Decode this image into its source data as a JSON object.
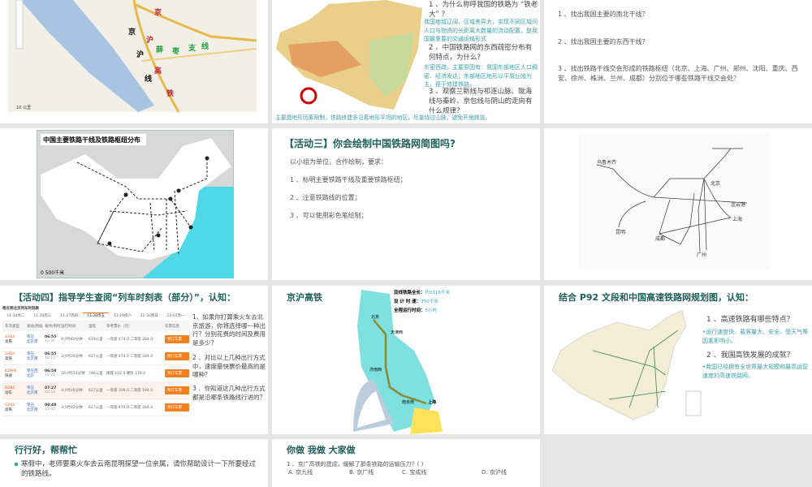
{
  "slide1": {
    "map_labels": [
      "京",
      "沪",
      "线",
      "京",
      "沪",
      "高",
      "铁",
      "薛",
      "枣",
      "支",
      "线"
    ],
    "scale": "10 公里"
  },
  "slide2": {
    "q1": "1 、为什么称呼我国的铁路为 “铁老大” ？",
    "a1": "我国地域辽阔，区域差异大，实现不同区域间人口与物资的长距离大数量的流动配置，是我国最重要的交通运输形式",
    "q2": "2 、中国铁路网的东西疏密分布有何特点，为什么？",
    "a2": "东密西疏。主要原因有：我国东部地区人口稠密、经济发达；东部地区地形以平原丘陵为主，便于修建铁路。",
    "q3": "3 、观察兰新线与祁连山脉、陇海线与秦岭、京包线与阴山的走向有什么规律？",
    "a3": "主要受地形因素限制，铁路修建多沿着地形平坦的地区，尽量绕过山脉，避免开凿隧道。"
  },
  "slide3": {
    "items": [
      "1 、找出我国主要的南北干线？",
      "2 、找出我国主要的东西干线？",
      "3 、找出铁路干线交会形成的铁路枢纽（北京、上海、广州、郑州、沈阳、重庆、西安、徐州、株洲、兰州、成都）分别位于哪些铁路干线交会处？"
    ]
  },
  "slide4": {
    "title": "中国主要铁路干线及铁路枢纽分布",
    "scale": "0      500千米"
  },
  "slide5": {
    "title": "【活动三】你会绘制中国铁路网简图吗?",
    "intro": "以小组为单位，合作绘制，要求：",
    "items": [
      "1 、标明主要铁路干线及重要铁路枢纽；",
      "2 、注意铁路线的位置；",
      "3 、可以使用彩色笔绘制；"
    ]
  },
  "slide6": {
    "labels": [
      "上海",
      "广州",
      "乌鲁木齐",
      "北京",
      "连云港",
      "昆明",
      "成都"
    ]
  },
  "slide7": {
    "title": "【活动四】指导学生查阅“列车时刻表（部分）”，认知：",
    "table_caption": "枣庄到北京列车时刻表",
    "tabs": [
      "11-24周二",
      "11-26周三",
      "11-27周四",
      "11-28周五",
      "11-29周六",
      "11-30周日",
      "12-01周一"
    ],
    "headers": [
      "车次类型",
      "发站/到站",
      "发时/到时",
      "运行时间",
      "里程",
      "参考票价（元）",
      "车票信息"
    ],
    "rows": [
      {
        "train": "G164",
        "type": "高铁",
        "from": "枣庄",
        "to": "北京南",
        "dep": "06:55",
        "arr": "12:37",
        "dur": "4小时40分钟",
        "dist": "619公里",
        "price": "一等座 474.0 二等座 284.0",
        "btn": "预订车票"
      },
      {
        "train": "G464",
        "type": "高铁",
        "from": "枣庄",
        "to": "北京南",
        "dep": "06:55",
        "arr": "10:15",
        "dur": "3小时20分钟",
        "dist": "627公里",
        "price": "一等座 474.0 二等座 284.0",
        "btn": "预订车票"
      },
      {
        "train": "K2906",
        "type": "快速",
        "from": "枣庄西",
        "to": "北京",
        "dep": "06:58",
        "arr": "17:21",
        "dur": "10小时23分钟",
        "dist": "746公里",
        "price": "硬座 102.0 硬卧 178.0",
        "btn": "预订车票"
      },
      {
        "train": "D282",
        "type": "动车",
        "from": "枣庄",
        "to": "北京南",
        "dep": "07:27",
        "arr": "10:53",
        "dur": "3小时26分钟",
        "dist": "627公里",
        "price": "一等座 309.0 二等座 194.0",
        "btn": "预订车票"
      },
      {
        "train": "G202",
        "type": "高铁",
        "from": "枣庄",
        "to": "北京南",
        "dep": "08:48",
        "arr": "11:32",
        "dur": "3小时02分钟",
        "dist": "627公里",
        "price": "一等座 474.0 二等座 284.0",
        "btn": "预订车票"
      }
    ],
    "questions": [
      "1、如果你打算乘火车去北京旅游，你将选择哪一种出行？分别花费的时间及费用是多少？",
      "2 、对比以上几种出行方式中，速度最快票价最高的是哪种？",
      "3 、你知道这几种出行方式都是沿哪条铁路线行进的？"
    ]
  },
  "slide8": {
    "title": "京沪高铁",
    "stats": [
      {
        "k": "双线铁路全长：",
        "v": "约1318千米"
      },
      {
        "k": "设 计 时 速：",
        "v": "350千米"
      },
      {
        "k": "全程运行时间：",
        "v": "5小时"
      }
    ],
    "stations": [
      "北京",
      "天津西",
      "济南西",
      "南京南",
      "上海"
    ]
  },
  "slide9": {
    "title": "结合 P92 文段和中国高速铁路网规划图，认知：",
    "q1": "1 、高速铁路有哪些特点？",
    "a1": "•运行速度快、载客量大、安全、受天气等因素影响小。",
    "q2": "2 、我国高铁发展的成就？",
    "a2": "•我国已经拥有全世界最大规模和最高运营速度的高速铁路网。"
  },
  "slide10": {
    "title": "行行好，帮帮忙",
    "text": "寒假中，老师要乘火车去云南昆明探望一位亲属，请你帮助设计一下所要经过的铁路线。"
  },
  "slide11": {
    "title": "你做 我做 大家做",
    "q1": "1 、京广高铁的建成，缓解了那条铁路的运输压力？(        )",
    "options": [
      "A. 京九线",
      "B. 京广线",
      "C. 宝成线",
      "D. 京沪线"
    ]
  },
  "colors": {
    "title": "#1f5f5a",
    "answer": "#3fa0a8",
    "accent": "#f08020",
    "sea": "#4fd8e8"
  }
}
